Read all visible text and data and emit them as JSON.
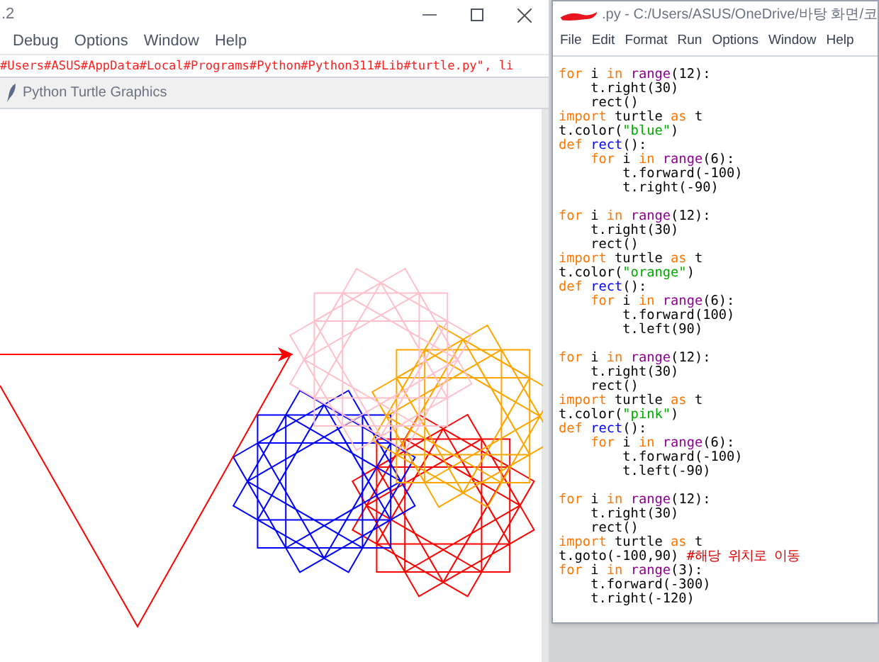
{
  "shell_window": {
    "title": ".2",
    "menu": [
      "Debug",
      "Options",
      "Window",
      "Help"
    ],
    "error_line": "#Users#ASUS#AppData#Local#Programs#Python#Python311#Lib#turtle.py\", li"
  },
  "turtle_window": {
    "title": "Python Turtle Graphics",
    "shapes": [
      {
        "kind": "rosette",
        "color": "#ff0000"
      },
      {
        "kind": "rosette",
        "color": "#0000ff"
      },
      {
        "kind": "rosette",
        "color": "#ffa500"
      },
      {
        "kind": "rosette",
        "color": "#ffc0cb"
      },
      {
        "kind": "triangle",
        "color": "#ff0000"
      }
    ]
  },
  "editor_window": {
    "title": ".py - C:/Users/ASUS/OneDrive/바탕 화면/코",
    "menu": [
      "File",
      "Edit",
      "Format",
      "Run",
      "Options",
      "Window",
      "Help"
    ],
    "lines": [
      {
        "tokens": [
          {
            "kind": "keyword",
            "text": "for"
          },
          {
            "kind": "plain",
            "text": " i "
          },
          {
            "kind": "keyword",
            "text": "in"
          },
          {
            "kind": "builtin",
            "text": " range"
          },
          {
            "kind": "plain",
            "text": "(12):"
          }
        ]
      },
      {
        "tokens": [
          {
            "kind": "plain",
            "text": "    t.right(30)"
          }
        ]
      },
      {
        "tokens": [
          {
            "kind": "plain",
            "text": "    rect()"
          }
        ]
      },
      {
        "tokens": [
          {
            "kind": "keyword",
            "text": "import"
          },
          {
            "kind": "plain",
            "text": " turtle "
          },
          {
            "kind": "keyword",
            "text": "as"
          },
          {
            "kind": "plain",
            "text": " t"
          }
        ]
      },
      {
        "tokens": [
          {
            "kind": "plain",
            "text": "t.color("
          },
          {
            "kind": "string",
            "text": "\"blue\""
          },
          {
            "kind": "plain",
            "text": ")"
          }
        ]
      },
      {
        "tokens": [
          {
            "kind": "keyword",
            "text": "def"
          },
          {
            "kind": "defname",
            "text": " rect"
          },
          {
            "kind": "plain",
            "text": "():"
          }
        ]
      },
      {
        "tokens": [
          {
            "kind": "keyword",
            "text": "    for"
          },
          {
            "kind": "plain",
            "text": " i "
          },
          {
            "kind": "keyword",
            "text": "in"
          },
          {
            "kind": "builtin",
            "text": " range"
          },
          {
            "kind": "plain",
            "text": "(6):"
          }
        ]
      },
      {
        "tokens": [
          {
            "kind": "plain",
            "text": "        t.forward(-100)"
          }
        ]
      },
      {
        "tokens": [
          {
            "kind": "plain",
            "text": "        t.right(-90)"
          }
        ]
      },
      {
        "kind": "blank"
      },
      {
        "tokens": [
          {
            "kind": "keyword",
            "text": "for"
          },
          {
            "kind": "plain",
            "text": " i "
          },
          {
            "kind": "keyword",
            "text": "in"
          },
          {
            "kind": "builtin",
            "text": " range"
          },
          {
            "kind": "plain",
            "text": "(12):"
          }
        ]
      },
      {
        "tokens": [
          {
            "kind": "plain",
            "text": "    t.right(30)"
          }
        ]
      },
      {
        "tokens": [
          {
            "kind": "plain",
            "text": "    rect()"
          }
        ]
      },
      {
        "tokens": [
          {
            "kind": "keyword",
            "text": "import"
          },
          {
            "kind": "plain",
            "text": " turtle "
          },
          {
            "kind": "keyword",
            "text": "as"
          },
          {
            "kind": "plain",
            "text": " t"
          }
        ]
      },
      {
        "tokens": [
          {
            "kind": "plain",
            "text": "t.color("
          },
          {
            "kind": "string",
            "text": "\"orange\""
          },
          {
            "kind": "plain",
            "text": ")"
          }
        ]
      },
      {
        "tokens": [
          {
            "kind": "keyword",
            "text": "def"
          },
          {
            "kind": "defname",
            "text": " rect"
          },
          {
            "kind": "plain",
            "text": "():"
          }
        ]
      },
      {
        "tokens": [
          {
            "kind": "keyword",
            "text": "    for"
          },
          {
            "kind": "plain",
            "text": " i "
          },
          {
            "kind": "keyword",
            "text": "in"
          },
          {
            "kind": "builtin",
            "text": " range"
          },
          {
            "kind": "plain",
            "text": "(6):"
          }
        ]
      },
      {
        "tokens": [
          {
            "kind": "plain",
            "text": "        t.forward(100)"
          }
        ]
      },
      {
        "tokens": [
          {
            "kind": "plain",
            "text": "        t.left(90)"
          }
        ]
      },
      {
        "kind": "blank"
      },
      {
        "tokens": [
          {
            "kind": "keyword",
            "text": "for"
          },
          {
            "kind": "plain",
            "text": " i "
          },
          {
            "kind": "keyword",
            "text": "in"
          },
          {
            "kind": "builtin",
            "text": " range"
          },
          {
            "kind": "plain",
            "text": "(12):"
          }
        ]
      },
      {
        "tokens": [
          {
            "kind": "plain",
            "text": "    t.right(30)"
          }
        ]
      },
      {
        "tokens": [
          {
            "kind": "plain",
            "text": "    rect()"
          }
        ]
      },
      {
        "tokens": [
          {
            "kind": "keyword",
            "text": "import"
          },
          {
            "kind": "plain",
            "text": " turtle "
          },
          {
            "kind": "keyword",
            "text": "as"
          },
          {
            "kind": "plain",
            "text": " t"
          }
        ]
      },
      {
        "tokens": [
          {
            "kind": "plain",
            "text": "t.color("
          },
          {
            "kind": "string",
            "text": "\"pink\""
          },
          {
            "kind": "plain",
            "text": ")"
          }
        ]
      },
      {
        "tokens": [
          {
            "kind": "keyword",
            "text": "def"
          },
          {
            "kind": "defname",
            "text": " rect"
          },
          {
            "kind": "plain",
            "text": "():"
          }
        ]
      },
      {
        "tokens": [
          {
            "kind": "keyword",
            "text": "    for"
          },
          {
            "kind": "plain",
            "text": " i "
          },
          {
            "kind": "keyword",
            "text": "in"
          },
          {
            "kind": "builtin",
            "text": " range"
          },
          {
            "kind": "plain",
            "text": "(6):"
          }
        ]
      },
      {
        "tokens": [
          {
            "kind": "plain",
            "text": "        t.forward(-100)"
          }
        ]
      },
      {
        "tokens": [
          {
            "kind": "plain",
            "text": "        t.left(-90)"
          }
        ]
      },
      {
        "kind": "blank"
      },
      {
        "tokens": [
          {
            "kind": "keyword",
            "text": "for"
          },
          {
            "kind": "plain",
            "text": " i "
          },
          {
            "kind": "keyword",
            "text": "in"
          },
          {
            "kind": "builtin",
            "text": " range"
          },
          {
            "kind": "plain",
            "text": "(12):"
          }
        ]
      },
      {
        "tokens": [
          {
            "kind": "plain",
            "text": "    t.right(30)"
          }
        ]
      },
      {
        "tokens": [
          {
            "kind": "plain",
            "text": "    rect()"
          }
        ]
      },
      {
        "tokens": [
          {
            "kind": "keyword",
            "text": "import"
          },
          {
            "kind": "plain",
            "text": " turtle "
          },
          {
            "kind": "keyword",
            "text": "as"
          },
          {
            "kind": "plain",
            "text": " t"
          }
        ]
      },
      {
        "tokens": [
          {
            "kind": "plain",
            "text": "t.goto(-100,90) "
          },
          {
            "kind": "comment",
            "text": "#해당 위치로 이동"
          }
        ]
      },
      {
        "tokens": [
          {
            "kind": "keyword",
            "text": "for"
          },
          {
            "kind": "plain",
            "text": " i "
          },
          {
            "kind": "keyword",
            "text": "in"
          },
          {
            "kind": "builtin",
            "text": " range"
          },
          {
            "kind": "plain",
            "text": "(3):"
          }
        ]
      },
      {
        "tokens": [
          {
            "kind": "plain",
            "text": "    t.forward(-300)"
          }
        ]
      },
      {
        "tokens": [
          {
            "kind": "plain",
            "text": "    t.right(-120)"
          }
        ]
      }
    ]
  }
}
